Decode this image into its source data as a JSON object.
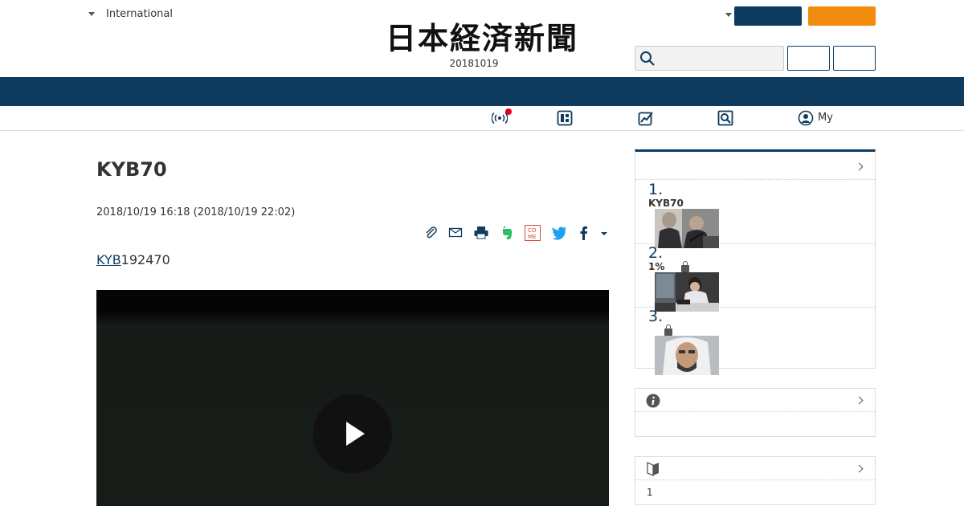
{
  "header": {
    "region_label": "International",
    "logo_text": "日本経済新聞",
    "date": "20181019",
    "search": {
      "placeholder": ""
    }
  },
  "subnav": {
    "my_label": "My"
  },
  "article": {
    "title": "KYB70",
    "published": "2018/10/19 16:18 (2018/10/19 22:02)",
    "lead_link": "KYB",
    "lead_rest": "192470"
  },
  "ranking": {
    "items": [
      {
        "num": "1.",
        "title": "KYB70",
        "locked": false
      },
      {
        "num": "2.",
        "title": "1%",
        "locked": true
      },
      {
        "num": "3.",
        "title": "",
        "locked": true
      }
    ]
  },
  "sidebar_box3": {
    "text": "1"
  },
  "colors": {
    "navy": "#0e3b5e",
    "orange": "#f28c0f",
    "notify_dot": "#e60012",
    "evernote": "#2dbe60",
    "twitter": "#1da1f2",
    "facebook": "#3b5998",
    "comment": "#d84a38"
  }
}
